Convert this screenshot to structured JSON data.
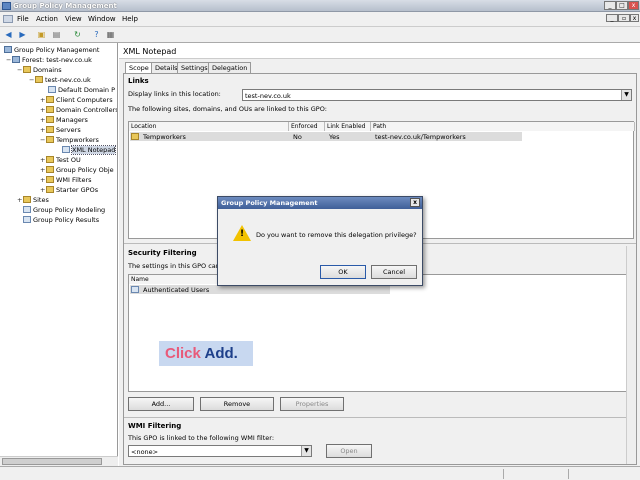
{
  "window": {
    "title": "Group Policy Management"
  },
  "menu": [
    "File",
    "Action",
    "View",
    "Window",
    "Help"
  ],
  "tree": {
    "items": [
      {
        "label": "Group Policy Management",
        "kind": "root"
      },
      {
        "label": "Forest: test-nev.co.uk",
        "kind": "root"
      },
      {
        "label": "Domains",
        "kind": "folder"
      },
      {
        "label": "test-nev.co.uk",
        "kind": "folder"
      },
      {
        "label": "Default Domain P",
        "kind": "gpo"
      },
      {
        "label": "Client Computers",
        "kind": "folder"
      },
      {
        "label": "Domain Controllers",
        "kind": "folder"
      },
      {
        "label": "Managers",
        "kind": "folder"
      },
      {
        "label": "Servers",
        "kind": "folder"
      },
      {
        "label": "Tempworkers",
        "kind": "folder"
      },
      {
        "label": "XML Notepad",
        "kind": "gpo"
      },
      {
        "label": "Test OU",
        "kind": "folder"
      },
      {
        "label": "Group Policy Obje",
        "kind": "folder"
      },
      {
        "label": "WMI Filters",
        "kind": "folder"
      },
      {
        "label": "Starter GPOs",
        "kind": "folder"
      },
      {
        "label": "Sites",
        "kind": "folder"
      },
      {
        "label": "Group Policy Modeling",
        "kind": "gpo"
      },
      {
        "label": "Group Policy Results",
        "kind": "gpo"
      }
    ]
  },
  "main": {
    "title": "XML Notepad",
    "tabs": [
      "Scope",
      "Details",
      "Settings",
      "Delegation"
    ],
    "links": {
      "heading": "Links",
      "display_label": "Display links in this location:",
      "location_value": "test-nev.co.uk",
      "note": "The following sites, domains, and OUs are linked to this GPO:",
      "columns": [
        "Location",
        "Enforced",
        "Link Enabled",
        "Path"
      ],
      "rows": [
        {
          "location": "Tempworkers",
          "enforced": "No",
          "enabled": "Yes",
          "path": "test-nev.co.uk/Tempworkers"
        }
      ]
    },
    "security": {
      "heading": "Security Filtering",
      "note": "The settings in this GPO can only apply to the following groups, users, and computers:",
      "column": "Name",
      "rows": [
        "Authenticated Users"
      ],
      "buttons": [
        "Add...",
        "Remove",
        "Properties"
      ]
    },
    "wmi": {
      "heading": "WMI Filtering",
      "note": "This GPO is linked to the following WMI filter:",
      "value": "<none>",
      "open_label": "Open"
    }
  },
  "dialog": {
    "title": "Group Policy Management",
    "message": "Do you want to remove this delegation privilege?",
    "ok": "OK",
    "cancel": "Cancel"
  },
  "caption": {
    "click": "Click",
    "add": "Add",
    "dot": "."
  },
  "colors": {
    "caption_click": "#e85a7a",
    "caption_add": "#1d3f8a",
    "caption_bg": "#c8d8f0"
  }
}
